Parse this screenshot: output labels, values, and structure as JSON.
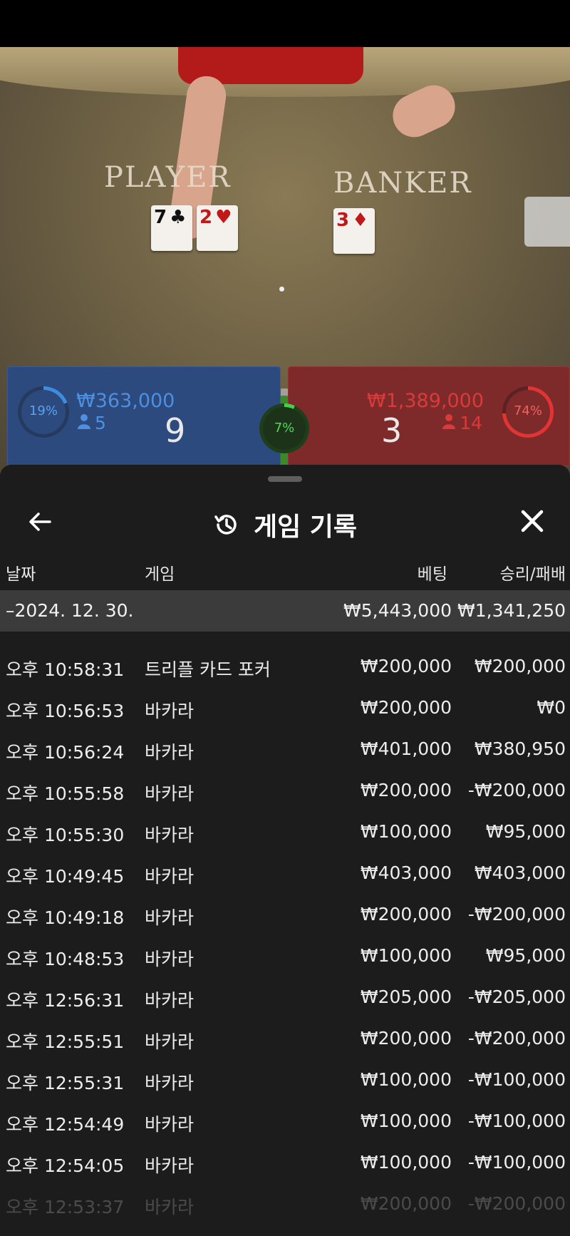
{
  "table": {
    "felt_player": "PLAYER",
    "felt_banker": "BANKER",
    "cards_player": [
      {
        "rank": "7",
        "suit": "♣",
        "color": "black"
      },
      {
        "rank": "2",
        "suit": "♥",
        "color": "red"
      }
    ],
    "cards_banker": [
      {
        "rank": "3",
        "suit": "♦",
        "color": "red"
      }
    ]
  },
  "bets": {
    "player": {
      "percent": "19%",
      "amount": "₩363,000",
      "players": "5",
      "score": "9"
    },
    "tie": {
      "percent": "7%"
    },
    "banker": {
      "percent": "74%",
      "amount": "₩1,389,000",
      "players": "14",
      "score": "3"
    }
  },
  "history": {
    "title": "게임 기록",
    "columns": {
      "date": "날짜",
      "game": "게임",
      "bet": "베팅",
      "win": "승리/패배"
    },
    "summary": {
      "date": "–2024. 12. 30.",
      "bet": "₩5,443,000",
      "win": "₩1,341,250"
    },
    "rows": [
      {
        "time": "오후 10:58:31",
        "game": "트리플 카드 포커",
        "bet": "₩200,000",
        "win": "₩200,000"
      },
      {
        "time": "오후 10:56:53",
        "game": "바카라",
        "bet": "₩200,000",
        "win": "₩0"
      },
      {
        "time": "오후 10:56:24",
        "game": "바카라",
        "bet": "₩401,000",
        "win": "₩380,950"
      },
      {
        "time": "오후 10:55:58",
        "game": "바카라",
        "bet": "₩200,000",
        "win": "-₩200,000"
      },
      {
        "time": "오후 10:55:30",
        "game": "바카라",
        "bet": "₩100,000",
        "win": "₩95,000"
      },
      {
        "time": "오후 10:49:45",
        "game": "바카라",
        "bet": "₩403,000",
        "win": "₩403,000"
      },
      {
        "time": "오후 10:49:18",
        "game": "바카라",
        "bet": "₩200,000",
        "win": "-₩200,000"
      },
      {
        "time": "오후 10:48:53",
        "game": "바카라",
        "bet": "₩100,000",
        "win": "₩95,000"
      },
      {
        "time": "오후 12:56:31",
        "game": "바카라",
        "bet": "₩205,000",
        "win": "-₩205,000"
      },
      {
        "time": "오후 12:55:51",
        "game": "바카라",
        "bet": "₩200,000",
        "win": "-₩200,000"
      },
      {
        "time": "오후 12:55:31",
        "game": "바카라",
        "bet": "₩100,000",
        "win": "-₩100,000"
      },
      {
        "time": "오후 12:54:49",
        "game": "바카라",
        "bet": "₩100,000",
        "win": "-₩100,000"
      },
      {
        "time": "오후 12:54:05",
        "game": "바카라",
        "bet": "₩100,000",
        "win": "-₩100,000"
      },
      {
        "time": "오후 12:53:37",
        "game": "바카라",
        "bet": "₩200,000",
        "win": "-₩200,000"
      }
    ]
  },
  "colors": {
    "player_blue": "#2c4a7e",
    "banker_red": "#7e2a2a",
    "tie_green": "#3a8a2a",
    "sheet_bg": "#1c1c1c",
    "summary_bg": "#3b3b3b"
  },
  "icons": {
    "back": "arrow-left-icon",
    "history": "history-clock-icon",
    "close": "close-x-icon",
    "person": "person-icon"
  }
}
